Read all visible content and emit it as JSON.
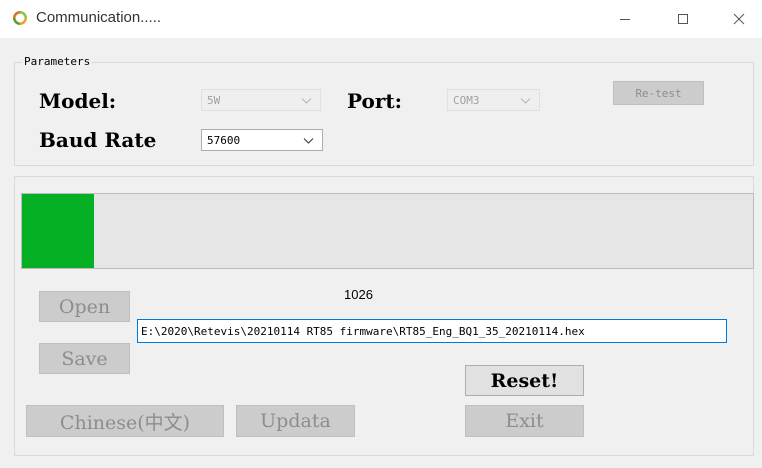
{
  "window": {
    "title": "Communication....."
  },
  "parameters": {
    "group_label": "Parameters",
    "model_label": "Model:",
    "model_value": "5W",
    "port_label": "Port:",
    "port_value": "COM3",
    "baud_label": "Baud Rate",
    "baud_value": "57600",
    "retest_label": "Re-test"
  },
  "progress": {
    "fraction": 0.098,
    "fill_color": "#06b025"
  },
  "counter": "1026",
  "file_path": "E:\\2020\\Retevis\\20210114 RT85 firmware\\RT85_Eng_BQ1_35_20210114.hex",
  "buttons": {
    "open": "Open",
    "save": "Save",
    "reset": "Reset!",
    "chinese": "Chinese(中文)",
    "updata": "Updata",
    "exit": "Exit"
  }
}
